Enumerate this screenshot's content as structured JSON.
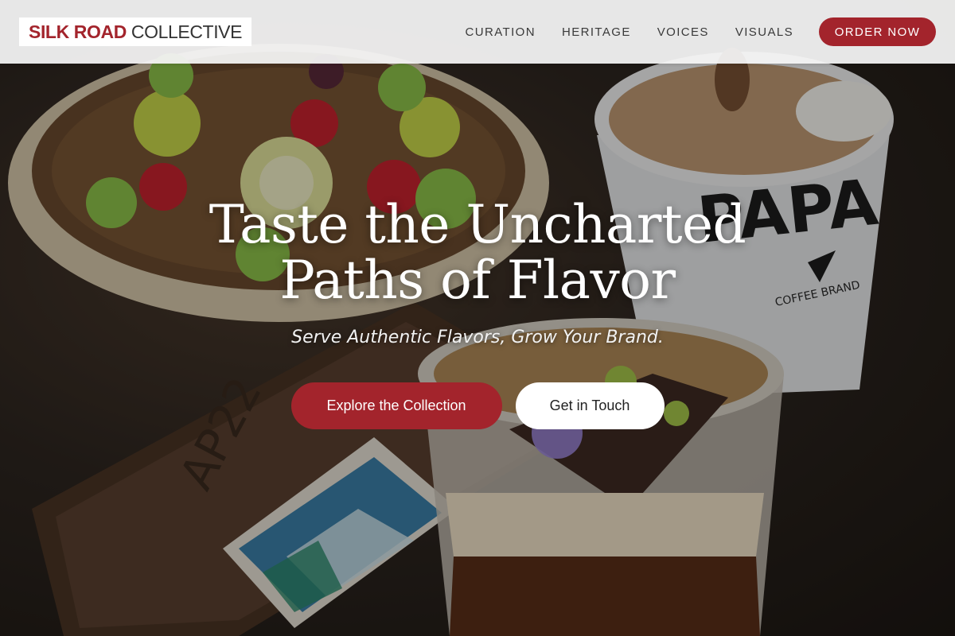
{
  "brand": {
    "name_bold": "SILK ROAD",
    "name_light": "COLLECTIVE"
  },
  "nav": {
    "links": [
      "CURATION",
      "HERITAGE",
      "VOICES",
      "VISUALS"
    ],
    "cta": "ORDER NOW"
  },
  "hero": {
    "headline_line1": "Taste the Uncharted",
    "headline_line2": "Paths of Flavor",
    "subheadline": "Serve Authentic Flavors, Grow Your Brand.",
    "primary_cta": "Explore the Collection",
    "secondary_cta": "Get in Touch"
  },
  "background_photo": {
    "cup_print": "PAPA",
    "tray_print": "AP22",
    "cup_brand_print": "COFFEE BRAND"
  },
  "colors": {
    "accent": "#a3242c",
    "header_bg": "#f4f4f4",
    "text_light": "#ffffff"
  }
}
